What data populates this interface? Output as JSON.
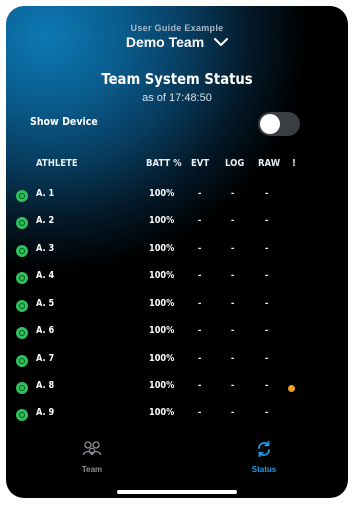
{
  "header": {
    "subtitle": "User Guide Example",
    "team_name": "Demo Team"
  },
  "status": {
    "title": "Team System Status",
    "as_of": "as of 17:48:50"
  },
  "show_device": {
    "label": "Show Device",
    "enabled": false
  },
  "table": {
    "columns": [
      "ATHLETE",
      "BATT %",
      "EVT",
      "LOG",
      "RAW",
      "!"
    ],
    "rows": [
      {
        "athlete": "A. 1",
        "batt": "100%",
        "evt": "-",
        "log": "-",
        "raw": "-",
        "alert": false
      },
      {
        "athlete": "A. 2",
        "batt": "100%",
        "evt": "-",
        "log": "-",
        "raw": "-",
        "alert": false
      },
      {
        "athlete": "A. 3",
        "batt": "100%",
        "evt": "-",
        "log": "-",
        "raw": "-",
        "alert": false
      },
      {
        "athlete": "A. 4",
        "batt": "100%",
        "evt": "-",
        "log": "-",
        "raw": "-",
        "alert": false
      },
      {
        "athlete": "A. 5",
        "batt": "100%",
        "evt": "-",
        "log": "-",
        "raw": "-",
        "alert": false
      },
      {
        "athlete": "A. 6",
        "batt": "100%",
        "evt": "-",
        "log": "-",
        "raw": "-",
        "alert": false
      },
      {
        "athlete": "A. 7",
        "batt": "100%",
        "evt": "-",
        "log": "-",
        "raw": "-",
        "alert": false
      },
      {
        "athlete": "A. 8",
        "batt": "100%",
        "evt": "-",
        "log": "-",
        "raw": "-",
        "alert": true
      },
      {
        "athlete": "A. 9",
        "batt": "100%",
        "evt": "-",
        "log": "-",
        "raw": "-",
        "alert": false
      }
    ]
  },
  "tabs": {
    "team": {
      "label": "Team",
      "icon": "people-icon"
    },
    "status": {
      "label": "Status",
      "icon": "sync-icon"
    }
  },
  "colors": {
    "accent": "#1e9be6",
    "status_ok": "#2fbf5c",
    "alert": "#f4a021"
  }
}
